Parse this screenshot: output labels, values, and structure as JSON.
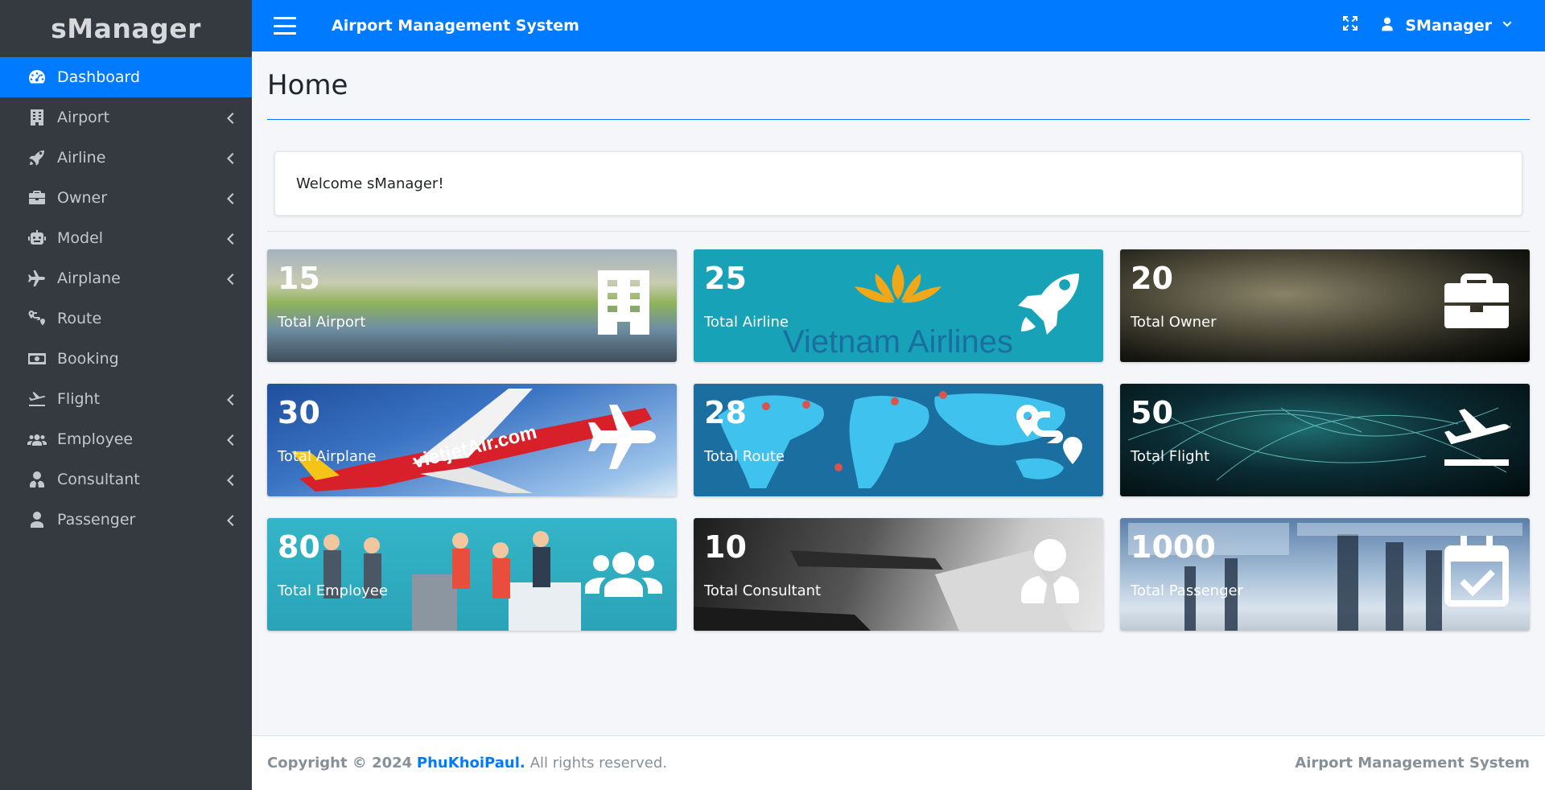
{
  "brand": "sManager",
  "header": {
    "title": "Airport Management System",
    "user": "SManager"
  },
  "sidebar": {
    "items": [
      {
        "label": "Dashboard",
        "icon": "tachometer-icon",
        "active": true,
        "has_submenu": false
      },
      {
        "label": "Airport",
        "icon": "building-icon",
        "has_submenu": true
      },
      {
        "label": "Airline",
        "icon": "rocket-icon",
        "has_submenu": true
      },
      {
        "label": "Owner",
        "icon": "briefcase-icon",
        "has_submenu": true
      },
      {
        "label": "Model",
        "icon": "robot-icon",
        "has_submenu": true
      },
      {
        "label": "Airplane",
        "icon": "plane-icon",
        "has_submenu": true
      },
      {
        "label": "Route",
        "icon": "route-icon",
        "has_submenu": false
      },
      {
        "label": "Booking",
        "icon": "money-bill-icon",
        "has_submenu": false
      },
      {
        "label": "Flight",
        "icon": "plane-departure-icon",
        "has_submenu": true
      },
      {
        "label": "Employee",
        "icon": "users-icon",
        "has_submenu": true
      },
      {
        "label": "Consultant",
        "icon": "user-tie-icon",
        "has_submenu": true
      },
      {
        "label": "Passenger",
        "icon": "user-icon",
        "has_submenu": true
      }
    ]
  },
  "main": {
    "page_title": "Home",
    "welcome": "Welcome sManager!",
    "tiles": [
      {
        "count": "15",
        "label": "Total Airport",
        "icon": "building-icon"
      },
      {
        "count": "25",
        "label": "Total Airline",
        "icon": "rocket-icon",
        "watermark": "Vietnam Airlines"
      },
      {
        "count": "20",
        "label": "Total Owner",
        "icon": "briefcase-icon"
      },
      {
        "count": "30",
        "label": "Total Airplane",
        "icon": "plane-icon",
        "watermark": "vietjetAir.com"
      },
      {
        "count": "28",
        "label": "Total Route",
        "icon": "route-icon"
      },
      {
        "count": "50",
        "label": "Total Flight",
        "icon": "plane-departure-icon"
      },
      {
        "count": "80",
        "label": "Total Employee",
        "icon": "users-icon"
      },
      {
        "count": "10",
        "label": "Total Consultant",
        "icon": "user-tie-icon"
      },
      {
        "count": "1000",
        "label": "Total Passenger",
        "icon": "calendar-check-icon"
      }
    ]
  },
  "footer": {
    "copyright": "Copyright © 2024",
    "author": "PhuKhoiPaul.",
    "rights": "All rights reserved.",
    "app_name": "Airport Management System"
  },
  "colors": {
    "primary": "#007bff",
    "sidebar_bg": "#343a40",
    "sidebar_text": "#c2c7d0",
    "airline_tile": "#17a2b8"
  }
}
